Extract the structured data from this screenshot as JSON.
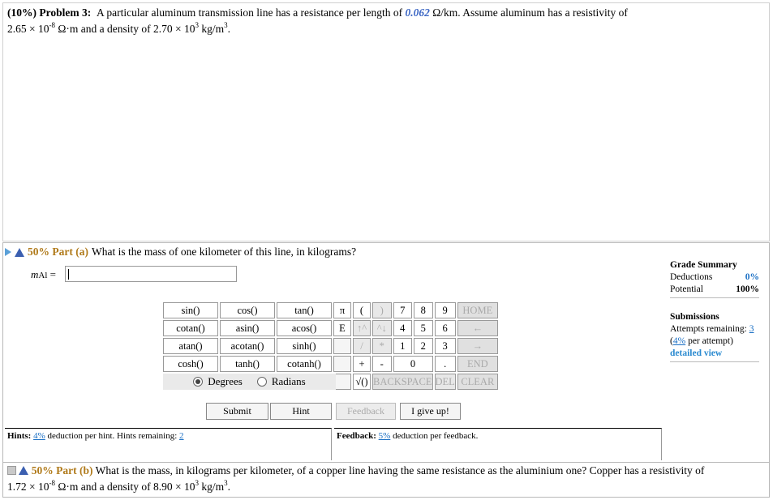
{
  "problem": {
    "header": "(10%) Problem 3:",
    "text_before": "A particular aluminum transmission line has a resistance per length of",
    "resistance_value": "0.062",
    "text_after_value": "Ω/km. Assume aluminum has a resistivity of",
    "line2_prefix": "2.65 × 10",
    "line2_exp1": "-8",
    "line2_mid": " Ω·m and a density of 2.70 × 10",
    "line2_exp2": "3",
    "line2_unit": " kg/m",
    "line2_exp3": "3",
    "line2_end": "."
  },
  "part_a": {
    "percent": "50% Part (a)",
    "question": "What is the mass of one kilometer of this line, in kilograms?",
    "var_letter": "m",
    "var_sub": "Al",
    "equals": "=",
    "answer_value": ""
  },
  "keypad": {
    "functions": [
      [
        "sin()",
        "cos()",
        "tan()"
      ],
      [
        "cotan()",
        "asin()",
        "acos()"
      ],
      [
        "atan()",
        "acotan()",
        "sinh()"
      ],
      [
        "cosh()",
        "tanh()",
        "cotanh()"
      ]
    ],
    "pi": "π",
    "e": "E",
    "open": "(",
    "close": ")",
    "up": "↑^",
    "down": "^↓",
    "slash": "/",
    "star": "*",
    "plus": "+",
    "minus": "-",
    "sqrt": "√()",
    "digits": [
      "7",
      "8",
      "9",
      "4",
      "5",
      "6",
      "1",
      "2",
      "3",
      "0",
      "."
    ],
    "home": "HOME",
    "left": "←",
    "right": "→",
    "end": "END",
    "backspace": "BACKSPACE",
    "del": "DEL",
    "clear": "CLEAR",
    "degrees": "Degrees",
    "radians": "Radians"
  },
  "buttons": {
    "submit": "Submit",
    "hint": "Hint",
    "feedback": "Feedback",
    "give_up": "I give up!"
  },
  "hints": {
    "label": "Hints:",
    "pct": "4%",
    "text": "deduction per hint. Hints remaining:",
    "remaining": "2"
  },
  "feedback": {
    "label": "Feedback:",
    "pct": "5%",
    "text": "deduction per feedback."
  },
  "grade_summary": {
    "title": "Grade Summary",
    "deductions_label": "Deductions",
    "deductions_value": "0%",
    "potential_label": "Potential",
    "potential_value": "100%"
  },
  "submissions": {
    "title": "Submissions",
    "attempts_label": "Attempts remaining:",
    "attempts_value": "3",
    "per_attempt_pct": "4%",
    "per_attempt_text": "per attempt)",
    "detailed_view": "detailed view"
  },
  "part_b": {
    "percent": "50% Part (b)",
    "question": "What is the mass, in kilograms per kilometer, of a copper line having the same resistance as the aluminium one? Copper has a resistivity of",
    "line2_prefix": "1.72 × 10",
    "line2_exp1": "-8",
    "line2_mid": " Ω·m and a density of 8.90 × 10",
    "line2_exp2": "3",
    "line2_unit": " kg/m",
    "line2_exp3": "3",
    "line2_end": "."
  },
  "colors": {
    "accent_blue": "#3b66c4",
    "percent_gold": "#b07a1a",
    "link_blue": "#1a6fc4"
  }
}
